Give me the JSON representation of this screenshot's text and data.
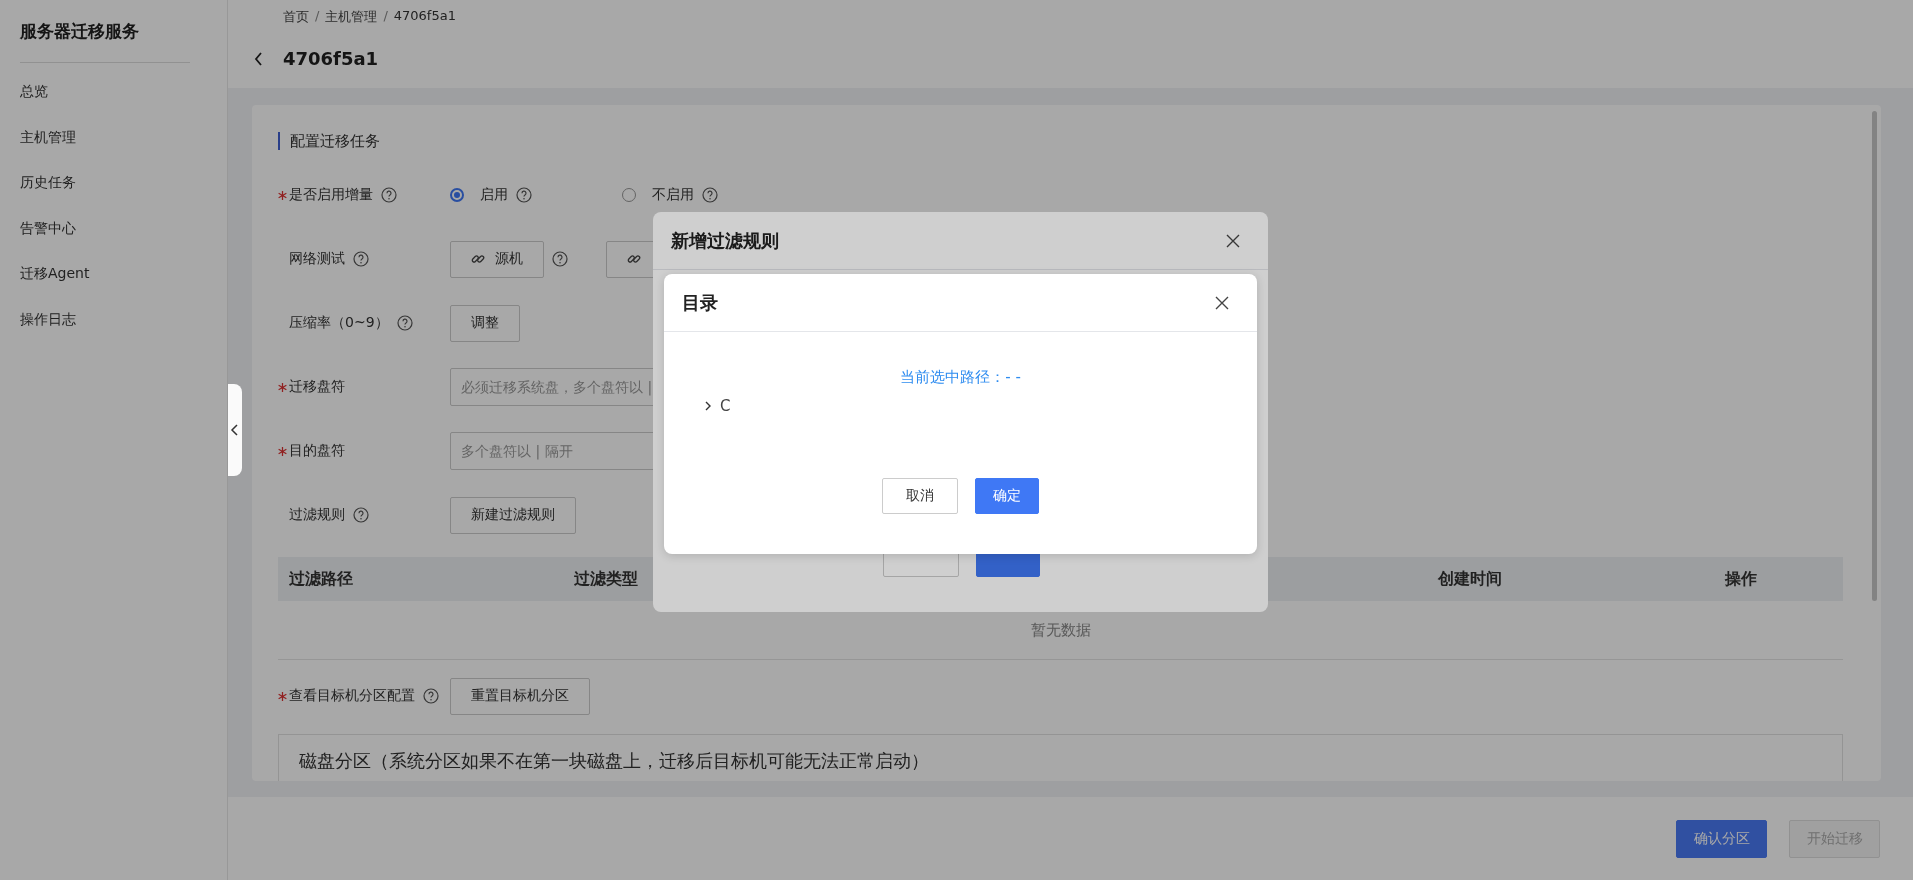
{
  "sidebar": {
    "title": "服务器迁移服务",
    "items": [
      {
        "label": "总览",
        "selected": false
      },
      {
        "label": "主机管理",
        "selected": false
      },
      {
        "label": "历史任务",
        "selected": false
      },
      {
        "label": "告警中心",
        "selected": false
      },
      {
        "label": "迁移Agent",
        "selected": false
      },
      {
        "label": "操作日志",
        "selected": false
      }
    ]
  },
  "breadcrumb": [
    {
      "kind": "link",
      "text": "首页"
    },
    {
      "kind": "separator",
      "text": "/"
    },
    {
      "kind": "link",
      "text": "主机管理"
    },
    {
      "kind": "separator",
      "text": "/"
    },
    {
      "kind": "current",
      "text": "4706f5a1"
    }
  ],
  "page_title": "4706f5a1",
  "section_title": "配置迁移任务",
  "form": [
    {
      "kind": "radio",
      "label": "是否启用增量",
      "required": true,
      "help": true,
      "options": [
        {
          "label": "启用",
          "selected": true,
          "help": true
        },
        {
          "label": "不启用",
          "selected": false,
          "help": true
        }
      ]
    },
    {
      "kind": "buttons",
      "label": "网络测试",
      "required": false,
      "help": true,
      "buttons": [
        {
          "kind": "link",
          "label": "源机",
          "help": true
        },
        {
          "kind": "link",
          "help": false
        }
      ]
    },
    {
      "kind": "buttons",
      "label": "压缩率（0~9）",
      "required": false,
      "help": true,
      "buttons": [
        {
          "kind": "plain",
          "label": "调整",
          "help": false
        }
      ]
    },
    {
      "kind": "input",
      "label": "迁移盘符",
      "required": true,
      "help": false,
      "placeholder": "必须迁移系统盘，多个盘符以 |"
    },
    {
      "kind": "input",
      "label": "目的盘符",
      "required": true,
      "help": false,
      "placeholder": "多个盘符以 | 隔开"
    },
    {
      "kind": "buttons",
      "label": "过滤规则",
      "required": false,
      "help": true,
      "buttons": [
        {
          "kind": "plain",
          "label": "新建过滤规则",
          "help": false
        }
      ]
    }
  ],
  "table": {
    "columns": [
      "过滤路径",
      "过滤类型",
      "创建时间",
      "操作"
    ],
    "empty_text": "暂无数据"
  },
  "partition_row": {
    "kind": "buttons",
    "label": "查看目标机分区配置",
    "required": true,
    "help": true,
    "buttons": [
      {
        "kind": "plain",
        "label": "重置目标机分区",
        "help": false
      }
    ]
  },
  "partition_box": {
    "title": "磁盘分区（系统分区如果不在第一块磁盘上，迁移后目标机可能无法正常启动）"
  },
  "footer_buttons": [
    {
      "label": "确认分区",
      "kind": "primary",
      "disabled": false
    },
    {
      "label": "开始迁移",
      "kind": "default",
      "disabled": true
    }
  ],
  "filter_dialog": {
    "title": "新增过滤规则"
  },
  "directory_dialog": {
    "title": "目录",
    "path_label": "当前选中路径：- -",
    "tree": [
      {
        "label": "C",
        "expanded": false
      }
    ],
    "buttons": [
      {
        "label": "取消",
        "kind": "default"
      },
      {
        "label": "确定",
        "kind": "primary"
      }
    ]
  }
}
